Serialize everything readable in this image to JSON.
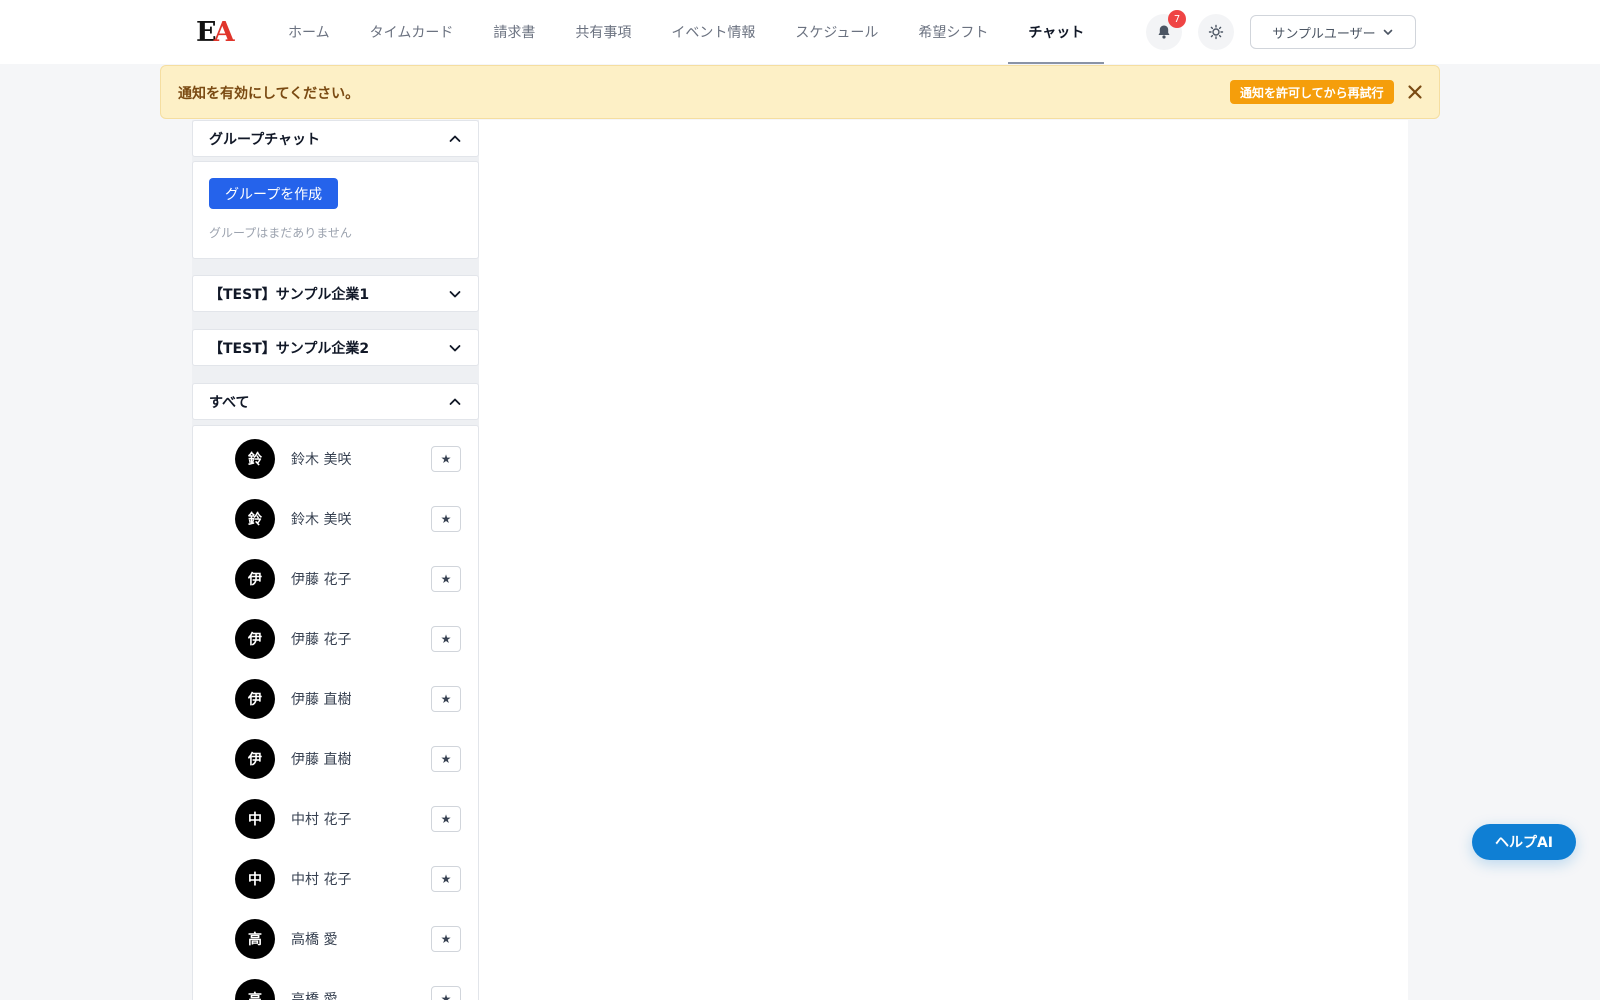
{
  "header": {
    "logo": {
      "left": "E",
      "right": "A"
    },
    "nav": [
      {
        "label": "ホーム",
        "active": false
      },
      {
        "label": "タイムカード",
        "active": false
      },
      {
        "label": "請求書",
        "active": false
      },
      {
        "label": "共有事項",
        "active": false
      },
      {
        "label": "イベント情報",
        "active": false
      },
      {
        "label": "スケジュール",
        "active": false
      },
      {
        "label": "希望シフト",
        "active": false
      },
      {
        "label": "チャット",
        "active": true
      }
    ],
    "notification_count": "7",
    "user_name": "サンプルユーザー"
  },
  "alert": {
    "message": "通知を有効にしてください。",
    "button_label": "通知を許可してから再試行"
  },
  "sidebar": {
    "group_chat": {
      "title": "グループチャット",
      "create_button": "グループを作成",
      "empty_text": "グループはまだありません"
    },
    "companies": [
      {
        "title": "【TEST】サンプル企業1"
      },
      {
        "title": "【TEST】サンプル企業2"
      }
    ],
    "all": {
      "title": "すべて",
      "members": [
        {
          "initial": "鈴",
          "name": "鈴木 美咲"
        },
        {
          "initial": "鈴",
          "name": "鈴木 美咲"
        },
        {
          "initial": "伊",
          "name": "伊藤 花子"
        },
        {
          "initial": "伊",
          "name": "伊藤 花子"
        },
        {
          "initial": "伊",
          "name": "伊藤 直樹"
        },
        {
          "initial": "伊",
          "name": "伊藤 直樹"
        },
        {
          "initial": "中",
          "name": "中村 花子"
        },
        {
          "initial": "中",
          "name": "中村 花子"
        },
        {
          "initial": "高",
          "name": "高橋 愛"
        },
        {
          "initial": "高",
          "name": "高橋 愛"
        }
      ],
      "favorite_symbol": "★"
    }
  },
  "help_button": "ヘルプAI",
  "colors": {
    "primary": "#2563eb",
    "alert_bg": "#fdf0c6",
    "alert_button": "#f59e0b",
    "help_button": "#0f7fd4",
    "badge": "#ef4444"
  }
}
